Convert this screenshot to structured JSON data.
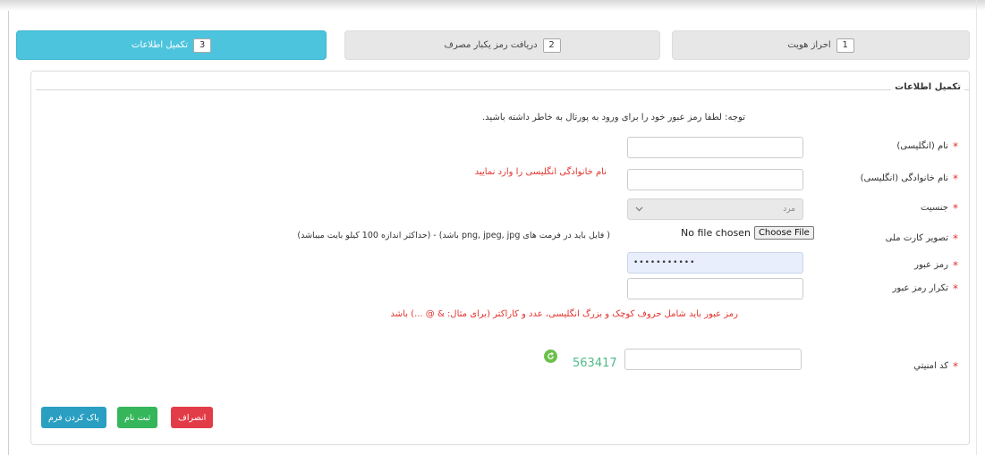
{
  "steps": [
    {
      "number": "1",
      "label": "احراز هويت",
      "active": false
    },
    {
      "number": "2",
      "label": "دريافت رمز يکبار مصرف",
      "active": false
    },
    {
      "number": "3",
      "label": "تکميل اطلاعات",
      "active": true
    }
  ],
  "panel": {
    "title": "تکميل اطلاعات",
    "note": "توجه: لطفا رمز عبور خود را برای ورود به پورتال به خاطر داشته باشيد."
  },
  "form": {
    "first_name": {
      "label": "نام (انگليسی)",
      "value": ""
    },
    "last_name": {
      "label": "نام خانوادگی (انگليسی)",
      "value": "",
      "error": "نام خانوادگی انگليسی را وارد نماييد"
    },
    "gender": {
      "label": "جنسيت",
      "selected": "مرد"
    },
    "id_card": {
      "label": "تصوير کارت ملی",
      "file_status": "No file chosen",
      "button": "Choose File",
      "hint": "( فايل بايد در فرمت های png, jpeg, jpg باشد) - (حداکثر اندازه 100 کيلو بايت ميباشد)"
    },
    "password": {
      "label": "رمز عبور",
      "value": "•••••••••••"
    },
    "password_repeat": {
      "label": "تکرار رمز عبور",
      "value": "",
      "rule": "رمز عبور بايد شامل حروف کوچک و بزرگ انگليسی، عدد و کاراکتر (برای مثال: & @ ...) باشد"
    },
    "captcha": {
      "label": "کد امنيتي",
      "value": "",
      "code": "563417"
    }
  },
  "buttons": {
    "cancel": "انصراف",
    "submit": "ثبت نام",
    "clear": "پاک کردن فرم"
  },
  "colors": {
    "active_step": "#4dc4dd",
    "required": "#e3342f",
    "cancel": "#e23c48",
    "submit": "#35b65a",
    "clear": "#2a9fc2"
  }
}
